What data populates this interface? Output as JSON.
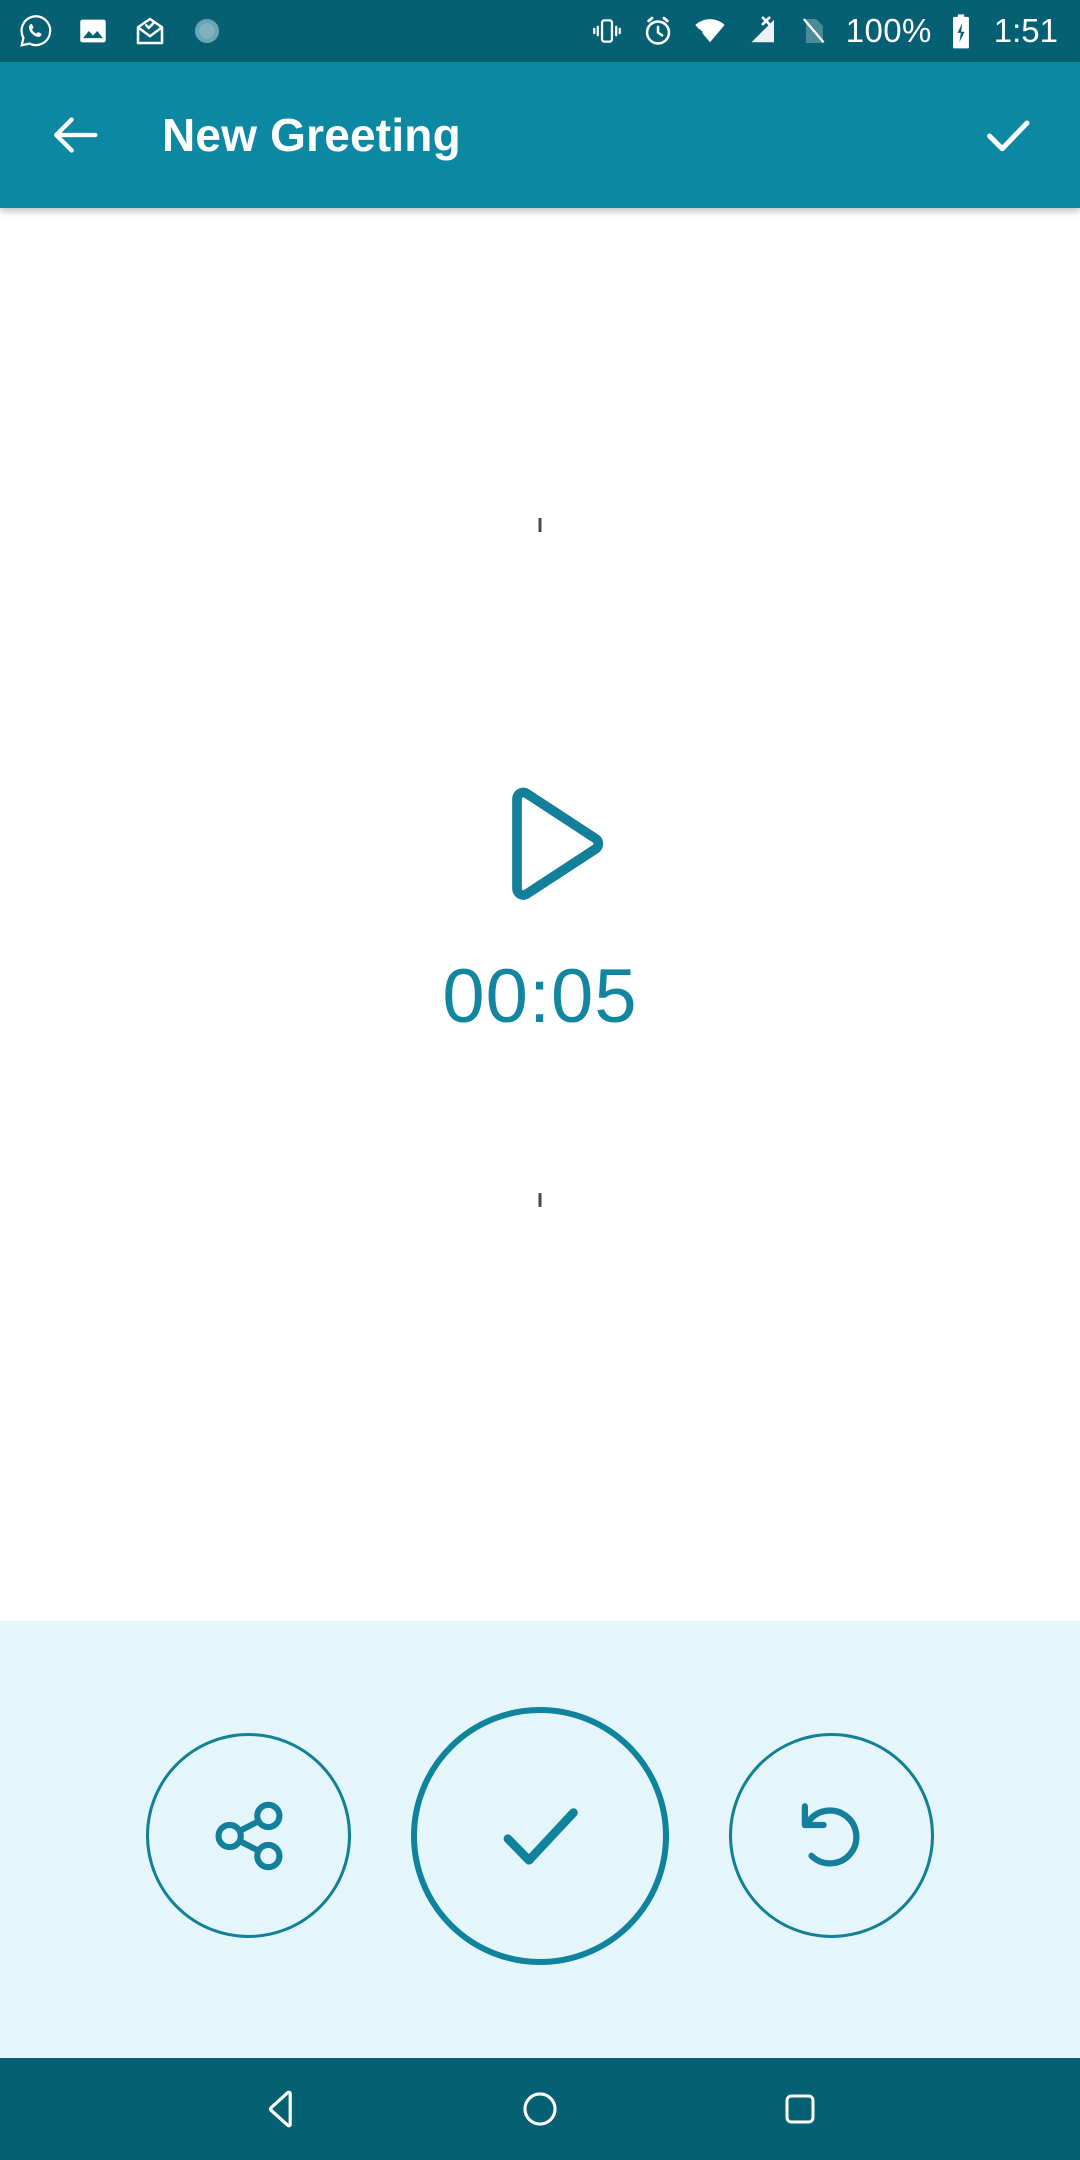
{
  "status_bar": {
    "background": "#056073",
    "left_icons": [
      {
        "name": "whatsapp-icon",
        "label": "WhatsApp"
      },
      {
        "name": "photo-icon",
        "label": "Photos"
      },
      {
        "name": "mail-open-icon",
        "label": "Mail"
      },
      {
        "name": "sync-icon",
        "label": "Sync"
      }
    ],
    "right_icons": [
      {
        "name": "vibrate-icon",
        "label": "Vibrate"
      },
      {
        "name": "alarm-icon",
        "label": "Alarm"
      },
      {
        "name": "wifi-icon",
        "label": "Wi-Fi"
      },
      {
        "name": "signal-off-icon",
        "label": "No signal"
      },
      {
        "name": "sim-off-icon",
        "label": "No SIM"
      }
    ],
    "battery_percent": "100%",
    "battery_icon": "battery-charging-icon",
    "clock": "1:51"
  },
  "app_bar": {
    "background": "#0d88a3",
    "back_icon": "arrow-back-icon",
    "title": "New Greeting",
    "confirm_icon": "check-icon"
  },
  "player": {
    "play_icon": "play-triangle-icon",
    "duration": "00:05",
    "accent_color": "#1286a0"
  },
  "footer": {
    "background": "#e5f5fc",
    "actions": [
      {
        "name": "share-button",
        "icon": "share-icon",
        "label": "Share",
        "size": "small"
      },
      {
        "name": "accept-button",
        "icon": "check-icon",
        "label": "Accept",
        "size": "large"
      },
      {
        "name": "redo-button",
        "icon": "rotate-left-icon",
        "label": "Redo",
        "size": "small"
      }
    ]
  },
  "nav_bar": {
    "background": "#056073",
    "buttons": [
      {
        "name": "nav-back-button",
        "icon": "triangle-back-icon",
        "label": "Back"
      },
      {
        "name": "nav-home-button",
        "icon": "circle-home-icon",
        "label": "Home"
      },
      {
        "name": "nav-recents-button",
        "icon": "square-recents-icon",
        "label": "Recents"
      }
    ]
  }
}
